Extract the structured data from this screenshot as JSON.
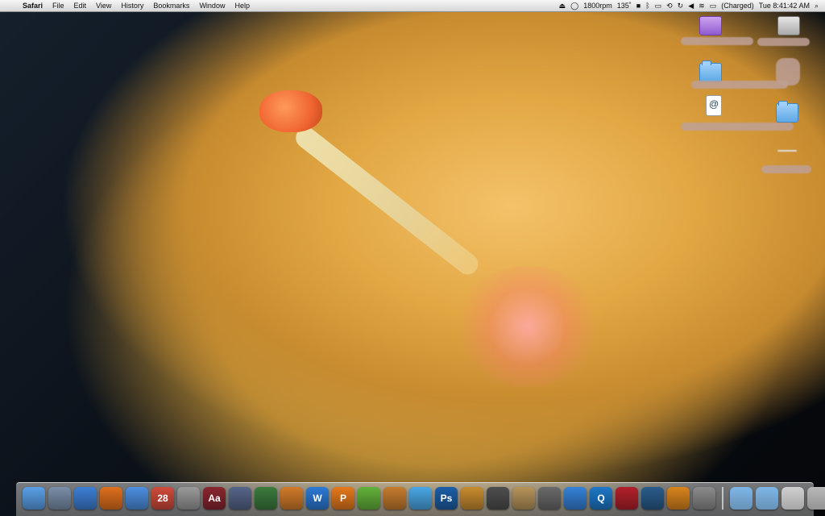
{
  "menubar": {
    "app_name": "Safari",
    "menus": [
      "File",
      "Edit",
      "View",
      "History",
      "Bookmarks",
      "Window",
      "Help"
    ],
    "status": {
      "fan_speed": "1800rpm",
      "temperature": "135˚",
      "battery": "(Charged)",
      "clock": "Tue 8:41:42 AM"
    }
  },
  "dock": {
    "items": [
      {
        "name": "finder",
        "glyph": "",
        "color": "#5aa0e8"
      },
      {
        "name": "preview-bird",
        "glyph": "",
        "color": "#7a8fa8"
      },
      {
        "name": "safari",
        "glyph": "",
        "color": "#3d7fd6"
      },
      {
        "name": "firefox",
        "glyph": "",
        "color": "#e0701d"
      },
      {
        "name": "ichat",
        "glyph": "",
        "color": "#4d8fe0"
      },
      {
        "name": "ical",
        "glyph": "28",
        "color": "#d24b3c"
      },
      {
        "name": "calculator",
        "glyph": "",
        "color": "#9a9a9a"
      },
      {
        "name": "dictionary",
        "glyph": "Aa",
        "color": "#8a2630"
      },
      {
        "name": "scripteditor",
        "glyph": "",
        "color": "#56658a"
      },
      {
        "name": "charts",
        "glyph": "",
        "color": "#3c7b3d"
      },
      {
        "name": "keynote",
        "glyph": "",
        "color": "#d27b2a"
      },
      {
        "name": "word",
        "glyph": "W",
        "color": "#2c7ad6"
      },
      {
        "name": "powerpoint",
        "glyph": "P",
        "color": "#e67a1c"
      },
      {
        "name": "messenger",
        "glyph": "",
        "color": "#63b23a"
      },
      {
        "name": "garageband",
        "glyph": "",
        "color": "#c67c2e"
      },
      {
        "name": "itunes",
        "glyph": "",
        "color": "#4aa7e6"
      },
      {
        "name": "photoshop",
        "glyph": "Ps",
        "color": "#1c5fa8"
      },
      {
        "name": "iphoto",
        "glyph": "",
        "color": "#c88c2f"
      },
      {
        "name": "photobooth",
        "glyph": "",
        "color": "#4e4e4e"
      },
      {
        "name": "preview",
        "glyph": "",
        "color": "#b7945a"
      },
      {
        "name": "imovie",
        "glyph": "",
        "color": "#6a6a6a"
      },
      {
        "name": "clapper",
        "glyph": "",
        "color": "#3582d8"
      },
      {
        "name": "quicktime",
        "glyph": "Q",
        "color": "#1e78c8"
      },
      {
        "name": "photobooth-red",
        "glyph": "",
        "color": "#b2202b"
      },
      {
        "name": "timemachine",
        "glyph": "",
        "color": "#2a5c8c"
      },
      {
        "name": "globe",
        "glyph": "",
        "color": "#d9851d"
      },
      {
        "name": "systemprefs",
        "glyph": "",
        "color": "#8c8c8c"
      }
    ],
    "right_items": [
      {
        "name": "documents-folder",
        "color": "#7fb6e6"
      },
      {
        "name": "applications-folder",
        "color": "#7fb6e6"
      },
      {
        "name": "stack",
        "color": "#d0d0d0"
      },
      {
        "name": "trash",
        "color": "#b8b8b8"
      }
    ]
  }
}
